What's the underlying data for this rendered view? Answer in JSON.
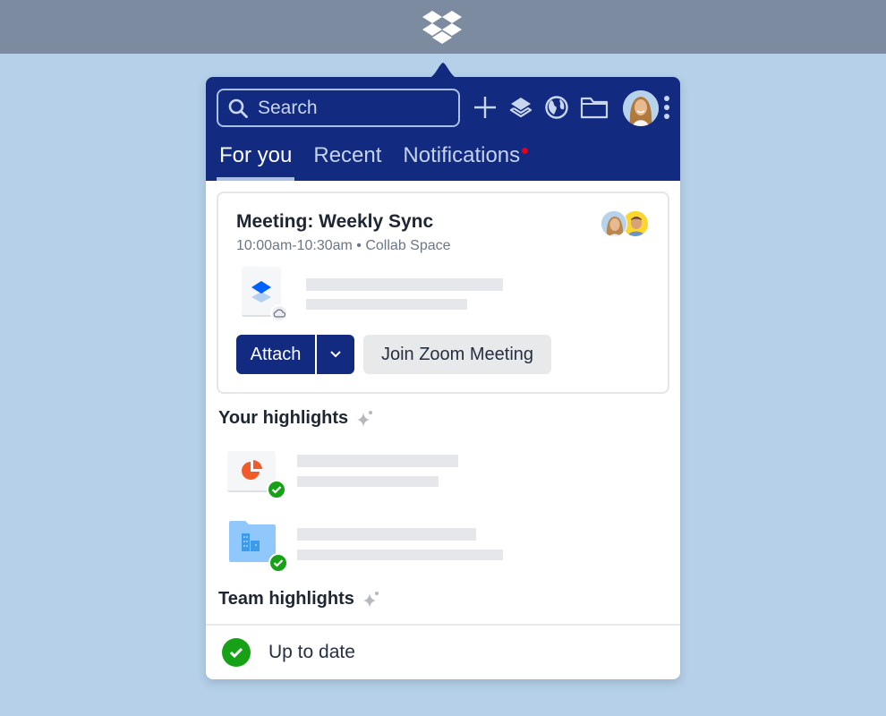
{
  "menubar": {
    "logo_icon": "dropbox-logo-icon"
  },
  "header": {
    "search": {
      "placeholder": "Search",
      "value": ""
    },
    "actions": [
      {
        "name": "create",
        "icon": "plus-icon"
      },
      {
        "name": "layers",
        "icon": "layers-icon"
      },
      {
        "name": "web",
        "icon": "globe-icon"
      },
      {
        "name": "folder",
        "icon": "folder-icon"
      }
    ],
    "avatar": "user-avatar",
    "more_icon": "more-vertical-icon"
  },
  "tabs": [
    {
      "label": "For you",
      "active": true
    },
    {
      "label": "Recent",
      "active": false
    },
    {
      "label": "Notifications",
      "active": false,
      "has_notification_dot": true
    }
  ],
  "meeting_card": {
    "title": "Meeting: Weekly Sync",
    "time": "10:00am-10:30am",
    "separator": "•",
    "location": "Collab Space",
    "subtitle": "10:00am-10:30am • Collab Space",
    "attendees": 2,
    "attach_label": "Attach",
    "join_label": "Join Zoom Meeting"
  },
  "your_highlights": {
    "heading": "Your highlights",
    "items": [
      {
        "type": "presentation",
        "icon": "pie-chart-file-icon",
        "status": "synced"
      },
      {
        "type": "team-folder",
        "icon": "team-folder-icon",
        "status": "synced"
      }
    ]
  },
  "team_highlights": {
    "heading": "Team highlights"
  },
  "footer": {
    "status": "Up to date"
  },
  "colors": {
    "brand_navy": "#122a80",
    "success": "#16a116",
    "notification": "#e3001b",
    "dropbox_blue": "#0061fe"
  }
}
